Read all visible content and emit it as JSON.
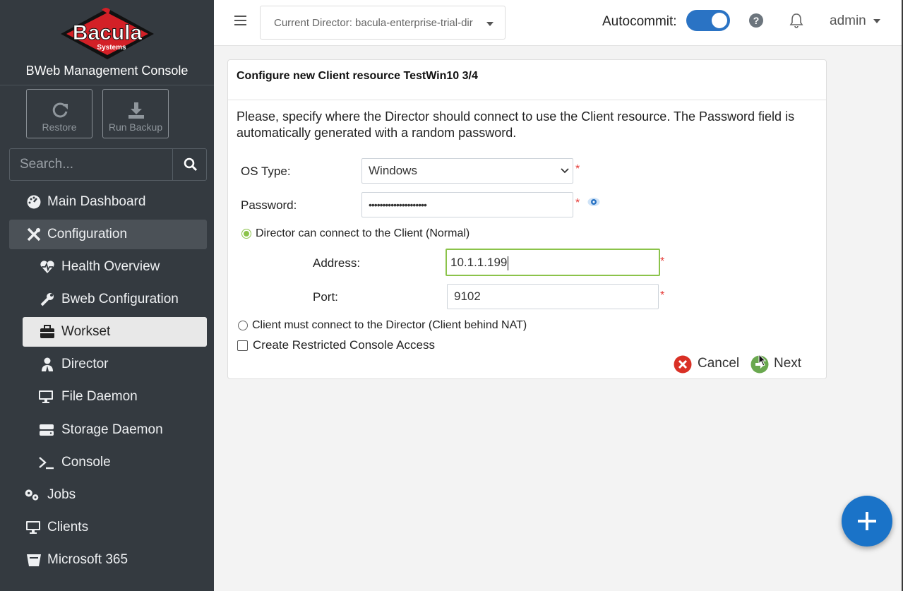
{
  "sidebar": {
    "logo_text": "Bacula",
    "logo_sub": "Systems",
    "console_title": "BWeb Management Console",
    "quick": {
      "restore": "Restore",
      "run_backup": "Run Backup"
    },
    "search_placeholder": "Search...",
    "items": [
      {
        "label": "Main Dashboard",
        "icon": "dashboard-icon"
      },
      {
        "label": "Configuration",
        "icon": "tools-icon"
      },
      {
        "label": "Health Overview",
        "icon": "heartbeat-icon"
      },
      {
        "label": "Bweb Configuration",
        "icon": "wrench-icon"
      },
      {
        "label": "Workset",
        "icon": "briefcase-icon"
      },
      {
        "label": "Director",
        "icon": "user-tie-icon"
      },
      {
        "label": "File Daemon",
        "icon": "desktop-icon"
      },
      {
        "label": "Storage Daemon",
        "icon": "hdd-icon"
      },
      {
        "label": "Console",
        "icon": "terminal-icon"
      },
      {
        "label": "Jobs",
        "icon": "cogs-icon"
      },
      {
        "label": "Clients",
        "icon": "desktop-icon"
      },
      {
        "label": "Microsoft 365",
        "icon": "bucket-icon"
      }
    ]
  },
  "topbar": {
    "director": "Current Director: bacula-enterprise-trial-dir",
    "autocommit_label": "Autocommit:",
    "autocommit_on": true,
    "user": "admin"
  },
  "card": {
    "title": "Configure new Client resource TestWin10 3/4",
    "description": "Please, specify where the Director should connect to use the Client resource. The Password field is automatically generated with a random password.",
    "os_label": "OS Type:",
    "os_value": "Windows",
    "password_label": "Password:",
    "password_value": "•••••••••••••••••••••",
    "radio_normal": "Director can connect to the Client (Normal)",
    "address_label": "Address:",
    "address_value": "10.1.1.199",
    "port_label": "Port:",
    "port_value": "9102",
    "radio_nat": "Client must connect to the Director (Client behind NAT)",
    "restricted_console": "Create Restricted Console Access",
    "cancel": "Cancel",
    "next": "Next",
    "required_mark": "*"
  },
  "colors": {
    "accent": "#1a73c8",
    "sidebar_bg": "#343a40",
    "focus_border": "#8bc34a",
    "required": "#e53935"
  }
}
